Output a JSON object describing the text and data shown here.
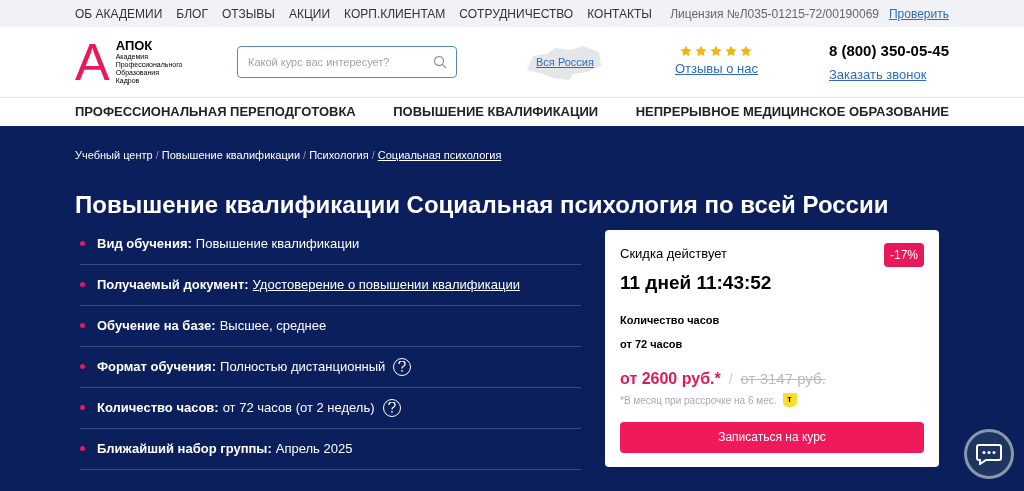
{
  "top_menu": [
    {
      "label": "ОБ АКАДЕМИИ"
    },
    {
      "label": "БЛОГ"
    },
    {
      "label": "ОТЗЫВЫ"
    },
    {
      "label": "АКЦИИ"
    },
    {
      "label": "КОРП.КЛИЕНТАМ"
    },
    {
      "label": "СОТРУДНИЧЕСТВО"
    },
    {
      "label": "КОНТАКТЫ"
    }
  ],
  "license": {
    "text": "Лицензия №Л035-01215-72/00190069",
    "link": "Проверить"
  },
  "logo": {
    "letter": "А",
    "name": "АПОК",
    "subtitle_lines": [
      "Академия",
      "Профессионального",
      "Образования",
      "Кадров"
    ]
  },
  "search": {
    "placeholder": "Какой курс вас интересует?"
  },
  "region": {
    "label": "Вся Россия"
  },
  "reviews": {
    "stars": 5,
    "link": "Отзывы о нас"
  },
  "contact": {
    "phone": "8 (800) 350-05-45",
    "callback": "Заказать звонок"
  },
  "main_nav": [
    {
      "label": "ПРОФЕССИОНАЛЬНАЯ ПЕРЕПОДГОТОВКА"
    },
    {
      "label": "ПОВЫШЕНИЕ КВАЛИФИКАЦИИ"
    },
    {
      "label": "НЕПРЕРЫВНОЕ МЕДИЦИНСКОЕ ОБРАЗОВАНИЕ"
    }
  ],
  "breadcrumbs": [
    {
      "label": "Учебный центр",
      "current": false
    },
    {
      "label": "Повышение квалификации",
      "current": false
    },
    {
      "label": "Психология",
      "current": false
    },
    {
      "label": "Социальная психология",
      "current": true
    }
  ],
  "breadcrumb_separator": "/",
  "title": "Повышение квалификации Социальная психология по всей России",
  "features": [
    {
      "label": "Вид обучения:",
      "value": "Повышение квалификации",
      "kind": "text",
      "help": false
    },
    {
      "label": "Получаемый документ:",
      "value": "Удостоверение о повышении квалификации",
      "kind": "link",
      "help": false
    },
    {
      "label": "Обучение на базе:",
      "value": "Высшее, среднее",
      "kind": "text",
      "help": false
    },
    {
      "label": "Формат обучения:",
      "value": "Полностью дистанционный",
      "kind": "text",
      "help": true
    },
    {
      "label": "Количество часов:",
      "value": "от 72 часов (от 2 недель)",
      "kind": "text",
      "help": true
    },
    {
      "label": "Ближайший набор группы:",
      "value": "Апрель 2025",
      "kind": "text",
      "help": false
    }
  ],
  "offer": {
    "discount_label": "Скидка действует",
    "countdown": "11 дней 11:43:52",
    "discount_badge": "-17%",
    "hours_label": "Количество часов",
    "hours_value": "от 72 часов",
    "price": "от 2600 руб.*",
    "separator": "/",
    "old_price": "от 3147 руб.",
    "installment_note": "*В месяц при рассрочке на 6 мес.",
    "bank_badge": "т",
    "button": "Записаться на курс"
  }
}
